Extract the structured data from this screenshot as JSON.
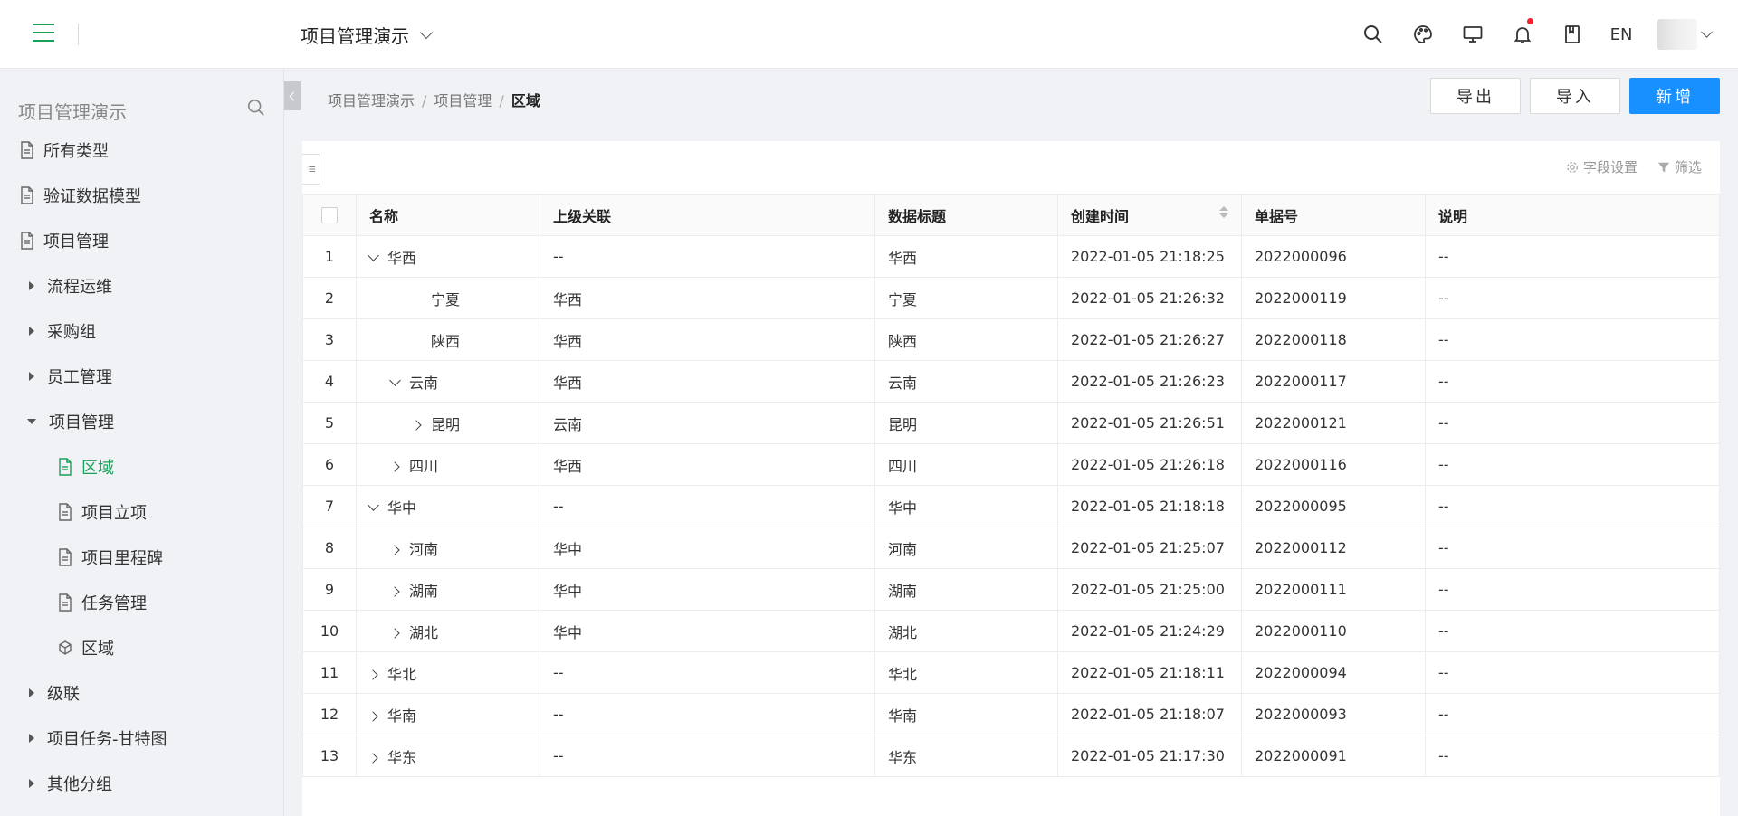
{
  "header": {
    "project": "项目管理演示",
    "lang": "EN",
    "icons": [
      "menu-icon",
      "search-icon",
      "palette-icon",
      "monitor-icon",
      "bell-icon",
      "book-icon"
    ]
  },
  "sidebar": {
    "title": "项目管理演示",
    "items": [
      {
        "label": "所有类型",
        "type": "doc"
      },
      {
        "label": "验证数据模型",
        "type": "doc"
      },
      {
        "label": "项目管理",
        "type": "doc"
      },
      {
        "label": "流程运维",
        "type": "group"
      },
      {
        "label": "采购组",
        "type": "group"
      },
      {
        "label": "员工管理",
        "type": "group"
      },
      {
        "label": "项目管理",
        "type": "group-open"
      },
      {
        "label": "区域",
        "type": "doc-child-active"
      },
      {
        "label": "项目立项",
        "type": "doc-child"
      },
      {
        "label": "项目里程碑",
        "type": "doc-child"
      },
      {
        "label": "任务管理",
        "type": "doc-child"
      },
      {
        "label": "区域",
        "type": "cube-child"
      },
      {
        "label": "级联",
        "type": "group"
      },
      {
        "label": "项目任务-甘特图",
        "type": "group"
      },
      {
        "label": "其他分组",
        "type": "group"
      }
    ]
  },
  "breadcrumb": {
    "items": [
      "项目管理演示",
      "项目管理"
    ],
    "current": "区域",
    "separator": "/"
  },
  "toolbar": {
    "export_label": "导出",
    "import_label": "导入",
    "add_label": "新增",
    "primary_color": "#1890ff"
  },
  "tools": {
    "fields": "字段设置",
    "filter": "筛选"
  },
  "table": {
    "columns": [
      "名称",
      "上级关联",
      "数据标题",
      "创建时间",
      "单据号",
      "说明"
    ],
    "rows": [
      {
        "idx": "1",
        "level": 0,
        "exp": "down",
        "name": "华西",
        "parent": "--",
        "title": "华西",
        "time": "2022-01-05 21:18:25",
        "no": "2022000096",
        "desc": "--"
      },
      {
        "idx": "2",
        "level": 2,
        "exp": "none",
        "name": "宁夏",
        "parent": "华西",
        "title": "宁夏",
        "time": "2022-01-05 21:26:32",
        "no": "2022000119",
        "desc": "--"
      },
      {
        "idx": "3",
        "level": 2,
        "exp": "none",
        "name": "陕西",
        "parent": "华西",
        "title": "陕西",
        "time": "2022-01-05 21:26:27",
        "no": "2022000118",
        "desc": "--"
      },
      {
        "idx": "4",
        "level": 1,
        "exp": "down",
        "name": "云南",
        "parent": "华西",
        "title": "云南",
        "time": "2022-01-05 21:26:23",
        "no": "2022000117",
        "desc": "--"
      },
      {
        "idx": "5",
        "level": 2,
        "exp": "right",
        "name": "昆明",
        "parent": "云南",
        "title": "昆明",
        "time": "2022-01-05 21:26:51",
        "no": "2022000121",
        "desc": "--"
      },
      {
        "idx": "6",
        "level": 1,
        "exp": "right",
        "name": "四川",
        "parent": "华西",
        "title": "四川",
        "time": "2022-01-05 21:26:18",
        "no": "2022000116",
        "desc": "--"
      },
      {
        "idx": "7",
        "level": 0,
        "exp": "down",
        "name": "华中",
        "parent": "--",
        "title": "华中",
        "time": "2022-01-05 21:18:18",
        "no": "2022000095",
        "desc": "--"
      },
      {
        "idx": "8",
        "level": 1,
        "exp": "right",
        "name": "河南",
        "parent": "华中",
        "title": "河南",
        "time": "2022-01-05 21:25:07",
        "no": "2022000112",
        "desc": "--"
      },
      {
        "idx": "9",
        "level": 1,
        "exp": "right",
        "name": "湖南",
        "parent": "华中",
        "title": "湖南",
        "time": "2022-01-05 21:25:00",
        "no": "2022000111",
        "desc": "--"
      },
      {
        "idx": "10",
        "level": 1,
        "exp": "right",
        "name": "湖北",
        "parent": "华中",
        "title": "湖北",
        "time": "2022-01-05 21:24:29",
        "no": "2022000110",
        "desc": "--"
      },
      {
        "idx": "11",
        "level": 0,
        "exp": "right",
        "name": "华北",
        "parent": "--",
        "title": "华北",
        "time": "2022-01-05 21:18:11",
        "no": "2022000094",
        "desc": "--"
      },
      {
        "idx": "12",
        "level": 0,
        "exp": "right",
        "name": "华南",
        "parent": "--",
        "title": "华南",
        "time": "2022-01-05 21:18:07",
        "no": "2022000093",
        "desc": "--"
      },
      {
        "idx": "13",
        "level": 0,
        "exp": "right",
        "name": "华东",
        "parent": "--",
        "title": "华东",
        "time": "2022-01-05 21:17:30",
        "no": "2022000091",
        "desc": "--"
      }
    ]
  }
}
